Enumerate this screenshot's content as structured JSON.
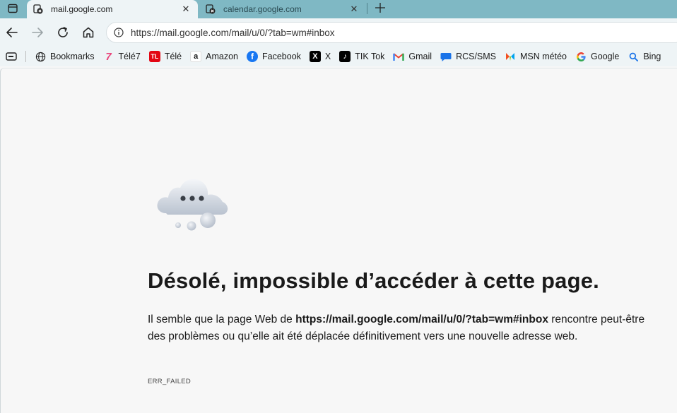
{
  "tabs": [
    {
      "title": "mail.google.com",
      "active": true
    },
    {
      "title": "calendar.google.com",
      "active": false
    }
  ],
  "toolbar": {
    "url": "https://mail.google.com/mail/u/0/?tab=wm#inbox"
  },
  "bookmarks": [
    {
      "label": "Bookmarks",
      "icon": "globe-icon"
    },
    {
      "label": "Télé7",
      "icon": "tele7-icon",
      "color": "#e9467c"
    },
    {
      "label": "Télé",
      "icon": "tl-icon",
      "color": "#e30613"
    },
    {
      "label": "Amazon",
      "icon": "amazon-icon"
    },
    {
      "label": "Facebook",
      "icon": "facebook-icon",
      "color": "#1877f2"
    },
    {
      "label": "X",
      "icon": "x-icon"
    },
    {
      "label": "TIK Tok",
      "icon": "tiktok-icon"
    },
    {
      "label": "Gmail",
      "icon": "gmail-icon"
    },
    {
      "label": "RCS/SMS",
      "icon": "messages-icon",
      "color": "#1a73e8"
    },
    {
      "label": "MSN météo",
      "icon": "msn-icon"
    },
    {
      "label": "Google",
      "icon": "google-icon"
    },
    {
      "label": "Bing",
      "icon": "search-icon"
    }
  ],
  "error": {
    "title": "Désolé, impossible d’accéder à cette page.",
    "desc_prefix": "Il semble que la page Web de ",
    "desc_url": "https://mail.google.com/mail/u/0/?tab=wm#inbox",
    "desc_suffix": " rencontre peut-être des problèmes ou qu’elle ait été déplacée définitivement vers une nouvelle adresse web.",
    "code": "ERR_FAILED"
  }
}
